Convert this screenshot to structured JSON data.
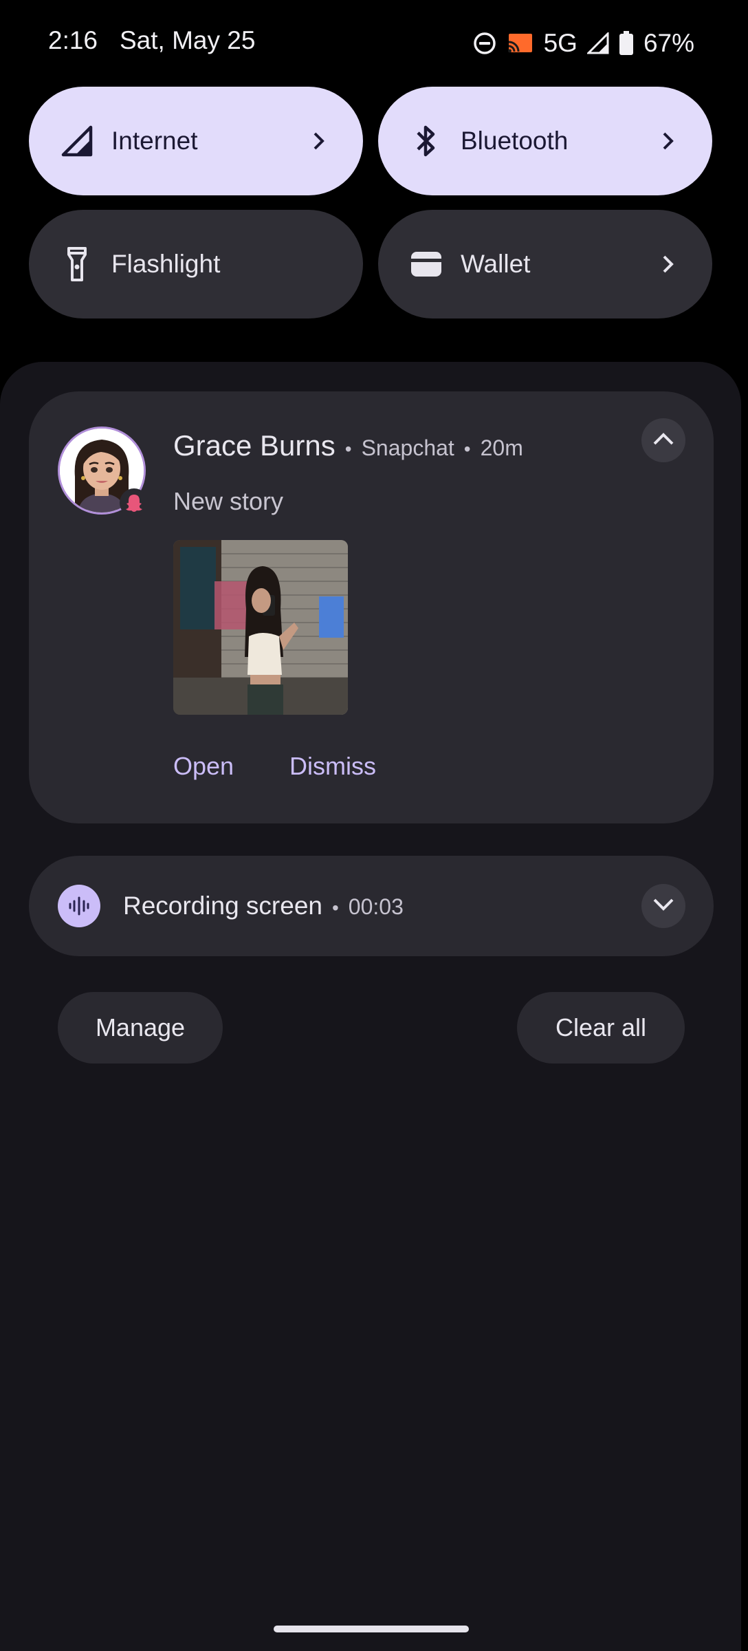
{
  "status_bar": {
    "time": "2:16",
    "date": "Sat, May 25",
    "network": "5G",
    "battery": "67%",
    "icons": [
      "do-not-disturb-icon",
      "cast-icon",
      "signal-icon",
      "battery-icon"
    ]
  },
  "quick_settings": {
    "tiles": [
      {
        "label": "Internet",
        "icon": "signal-icon",
        "active": true,
        "has_chevron": true
      },
      {
        "label": "Bluetooth",
        "icon": "bluetooth-icon",
        "active": true,
        "has_chevron": true
      },
      {
        "label": "Flashlight",
        "icon": "flashlight-icon",
        "active": false,
        "has_chevron": false
      },
      {
        "label": "Wallet",
        "icon": "wallet-icon",
        "active": false,
        "has_chevron": true
      }
    ]
  },
  "notifications": [
    {
      "sender": "Grace Burns",
      "app": "Snapchat",
      "time": "20m",
      "text": "New story",
      "avatar": "bitmoji-avatar",
      "badge": "snapchat-badge-icon",
      "actions": [
        "Open",
        "Dismiss"
      ]
    }
  ],
  "recording": {
    "title": "Recording screen",
    "elapsed": "00:03",
    "icon": "sound-wave-icon"
  },
  "footer": {
    "manage_label": "Manage",
    "clear_all_label": "Clear all"
  },
  "colors": {
    "active_tile": "#e2dcfb",
    "inactive_tile": "#2f2e35",
    "shade_bg": "#16151b",
    "card_bg": "#2a2930",
    "accent": "#cbbdf8"
  }
}
